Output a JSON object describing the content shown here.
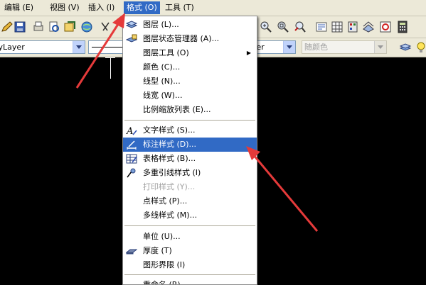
{
  "menubar": {
    "items": [
      {
        "label": "编辑 (E)",
        "active": false
      },
      {
        "label": "视图 (V)",
        "active": false
      },
      {
        "label": "插入 (I)",
        "active": false
      },
      {
        "label": "格式 (O)",
        "active": true
      },
      {
        "label": "工具 (T)",
        "active": false
      }
    ]
  },
  "toolbar": {
    "layer_combo_value": "ByLayer",
    "right_layer_combo_value": "yer",
    "color_combo_value": "随颜色"
  },
  "menu": {
    "items": [
      {
        "label": "图层 (L)...",
        "icon": "layers-icon"
      },
      {
        "label": "图层状态管理器 (A)...",
        "icon": "layer-state-icon"
      },
      {
        "label": "图层工具 (O)",
        "icon": "",
        "submenu": true
      },
      {
        "label": "颜色 (C)...",
        "icon": ""
      },
      {
        "label": "线型 (N)...",
        "icon": ""
      },
      {
        "label": "线宽 (W)...",
        "icon": ""
      },
      {
        "label": "比例缩放列表 (E)...",
        "icon": ""
      },
      {
        "label": "文字样式 (S)...",
        "icon": "text-style-icon"
      },
      {
        "label": "标注样式 (D)...",
        "icon": "dimension-style-icon",
        "selected": true
      },
      {
        "label": "表格样式 (B)...",
        "icon": "table-style-icon"
      },
      {
        "label": "多重引线样式 (I)",
        "icon": "multileader-style-icon"
      },
      {
        "label": "打印样式 (Y)...",
        "icon": "",
        "disabled": true
      },
      {
        "label": "点样式 (P)...",
        "icon": ""
      },
      {
        "label": "多线样式 (M)...",
        "icon": ""
      },
      {
        "label": "单位 (U)...",
        "icon": ""
      },
      {
        "label": "厚度 (T)",
        "icon": "thickness-icon"
      },
      {
        "label": "图形界限 (I)",
        "icon": ""
      },
      {
        "label": "重命名 (R)...",
        "icon": ""
      }
    ],
    "submenu_arrow": "▶"
  }
}
